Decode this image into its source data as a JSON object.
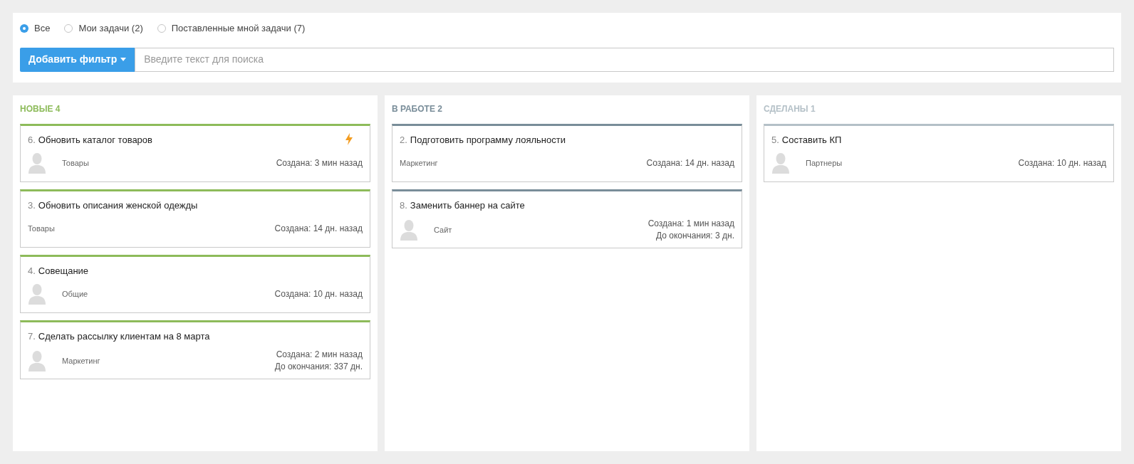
{
  "filters": [
    {
      "label": "Все",
      "selected": true
    },
    {
      "label": "Мои задачи (2)",
      "selected": false
    },
    {
      "label": "Поставленные мной задачи (7)",
      "selected": false
    }
  ],
  "add_filter_button": "Добавить фильтр",
  "search": {
    "placeholder": "Введите текст для поиска"
  },
  "columns": [
    {
      "title": "НОВЫЕ 4",
      "color": "#8dbb5a",
      "cards": [
        {
          "number": "6.",
          "title": "Обновить каталог товаров",
          "urgent": true,
          "avatar": true,
          "project": "Товары",
          "dates": [
            "Создана: 3 мин назад"
          ]
        },
        {
          "number": "3.",
          "title": "Обновить описания женской одежды",
          "urgent": false,
          "avatar": false,
          "project": "Товары",
          "dates": [
            "Создана: 14 дн. назад"
          ]
        },
        {
          "number": "4.",
          "title": "Совещание",
          "urgent": false,
          "avatar": true,
          "project": "Общие",
          "dates": [
            "Создана: 10 дн. назад"
          ]
        },
        {
          "number": "7.",
          "title": "Сделать рассылку клиентам на 8 марта",
          "urgent": false,
          "avatar": true,
          "project": "Маркетинг",
          "dates": [
            "Создана: 2 мин назад",
            "До окончания: 337 дн."
          ]
        }
      ]
    },
    {
      "title": "В РАБОТЕ 2",
      "color": "#798d99",
      "cards": [
        {
          "number": "2.",
          "title": "Подготовить программу лояльности",
          "urgent": false,
          "avatar": false,
          "project": "Маркетинг",
          "dates": [
            "Создана: 14 дн. назад"
          ]
        },
        {
          "number": "8.",
          "title": "Заменить баннер на сайте",
          "urgent": false,
          "avatar": true,
          "project": "Сайт",
          "dates": [
            "Создана: 1 мин назад",
            "До окончания: 3 дн."
          ]
        }
      ]
    },
    {
      "title": "СДЕЛАНЫ 1",
      "color": "#b4c0c7",
      "cards": [
        {
          "number": "5.",
          "title": "Составить КП",
          "urgent": false,
          "avatar": true,
          "project": "Партнеры",
          "dates": [
            "Создана: 10 дн. назад"
          ]
        }
      ]
    }
  ]
}
